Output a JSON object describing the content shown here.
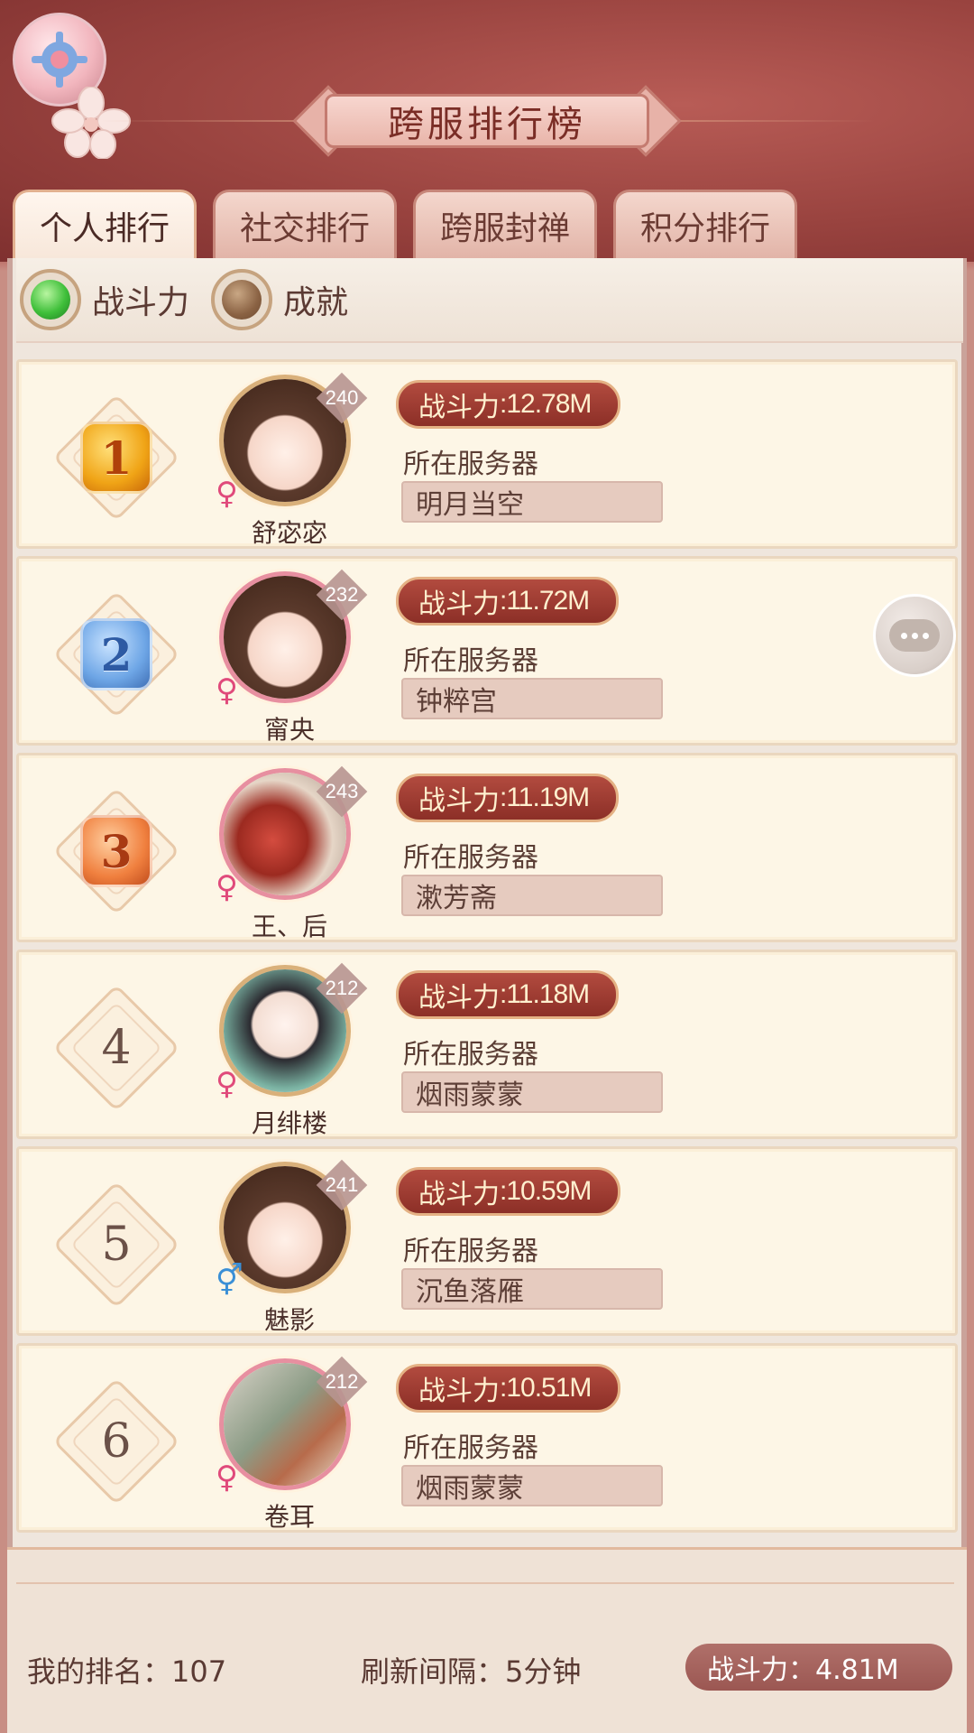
{
  "header": {
    "title": "跨服排行榜"
  },
  "tabs": [
    {
      "label": "个人排行",
      "active": true
    },
    {
      "label": "社交排行",
      "active": false
    },
    {
      "label": "跨服封禅",
      "active": false
    },
    {
      "label": "积分排行",
      "active": false
    }
  ],
  "filters": [
    {
      "label": "战斗力",
      "selected": true
    },
    {
      "label": "成就",
      "selected": false
    }
  ],
  "labels": {
    "power": "战斗力",
    "server": "所在服务器"
  },
  "rows": [
    {
      "rank": "1",
      "medal": "gold",
      "level": "240",
      "gender": "female",
      "name": "舒宓宓",
      "power": ":12.78M",
      "server": "明月当空",
      "avatar": "face"
    },
    {
      "rank": "2",
      "medal": "silver",
      "level": "232",
      "gender": "female",
      "name": "甯央",
      "power": ":11.72M",
      "server": "钟粹宫",
      "avatar": "face"
    },
    {
      "rank": "3",
      "medal": "bronze",
      "level": "243",
      "gender": "female",
      "name": "王、后",
      "power": ":11.19M",
      "server": "漱芳斋",
      "avatar": "photo"
    },
    {
      "rank": "4",
      "medal": "",
      "level": "212",
      "gender": "female",
      "name": "月绯楼",
      "power": ":11.18M",
      "server": "烟雨蒙蒙",
      "avatar": "girl"
    },
    {
      "rank": "5",
      "medal": "",
      "level": "241",
      "gender": "male",
      "name": "魅影",
      "power": ":10.59M",
      "server": "沉鱼落雁",
      "avatar": "face"
    },
    {
      "rank": "6",
      "medal": "",
      "level": "212",
      "gender": "female",
      "name": "卷耳",
      "power": ":10.51M",
      "server": "烟雨蒙蒙",
      "avatar": "couple"
    }
  ],
  "footer": {
    "my_rank": "我的排名：107",
    "refresh": "刷新间隔：5分钟",
    "my_power": "战斗力：4.81M"
  },
  "colors": {
    "header_bg": "#99433f",
    "row_bg": "#fdf6e6",
    "power_tag": "#8c2f27",
    "female": "#e04a7b",
    "male": "#3a8fd6"
  },
  "icons": {
    "settings": "gear-icon",
    "chat": "chat-bubble-icon",
    "female": "female-symbol-icon",
    "male": "male-symbol-icon"
  }
}
